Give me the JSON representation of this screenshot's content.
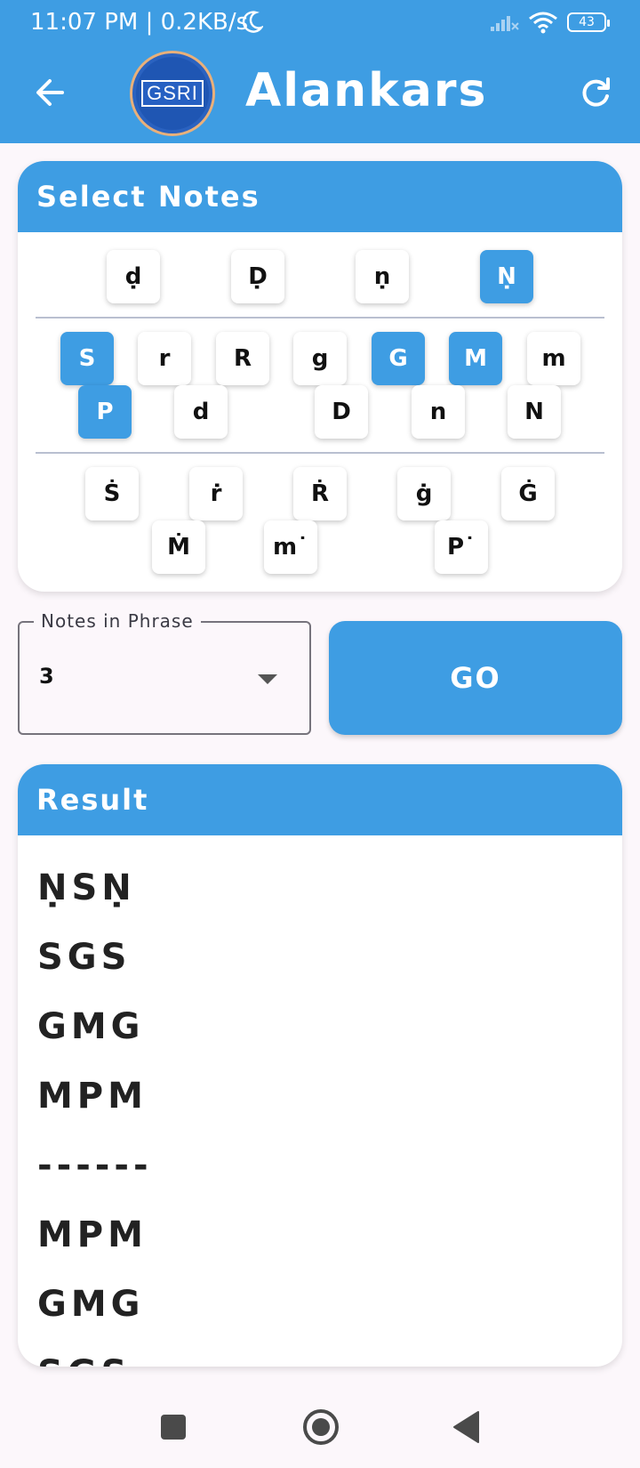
{
  "status_bar": {
    "time": "11:07 PM | 0.2KB/s",
    "battery": "43"
  },
  "app_bar": {
    "title": "Alankars",
    "logo_text": "GSRI"
  },
  "select_notes": {
    "header": "Select Notes",
    "row_lower": [
      {
        "label": "ḍ",
        "selected": false
      },
      {
        "label": "Ḍ",
        "selected": false
      },
      {
        "label": "ṇ",
        "selected": false
      },
      {
        "label": "Ṇ",
        "selected": true
      }
    ],
    "row_middle_a": [
      {
        "label": "S",
        "selected": true
      },
      {
        "label": "r",
        "selected": false
      },
      {
        "label": "R",
        "selected": false
      },
      {
        "label": "g",
        "selected": false
      },
      {
        "label": "G",
        "selected": true
      },
      {
        "label": "M",
        "selected": true
      },
      {
        "label": "m",
        "selected": false
      }
    ],
    "row_middle_b": [
      {
        "label": "P",
        "selected": true
      },
      {
        "label": "d",
        "selected": false
      },
      {
        "label": "D",
        "selected": false
      },
      {
        "label": "n",
        "selected": false
      },
      {
        "label": "N",
        "selected": false
      }
    ],
    "row_upper_a": [
      {
        "label": "Ṡ",
        "selected": false
      },
      {
        "label": "ṙ",
        "selected": false
      },
      {
        "label": "Ṙ",
        "selected": false
      },
      {
        "label": "ġ",
        "selected": false
      },
      {
        "label": "Ġ",
        "selected": false
      }
    ],
    "row_upper_b": [
      {
        "label": "Ṁ",
        "selected": false
      },
      {
        "label": "m˙",
        "selected": false
      },
      {
        "label": "P˙",
        "selected": false
      }
    ]
  },
  "phrase": {
    "label": "Notes in Phrase",
    "value": "3"
  },
  "go_label": "GO",
  "result": {
    "header": "Result",
    "items": [
      "ṆSṆ",
      "SGS",
      "GMG",
      "MPM",
      "------",
      "MPM",
      "GMG",
      "SGS"
    ]
  }
}
